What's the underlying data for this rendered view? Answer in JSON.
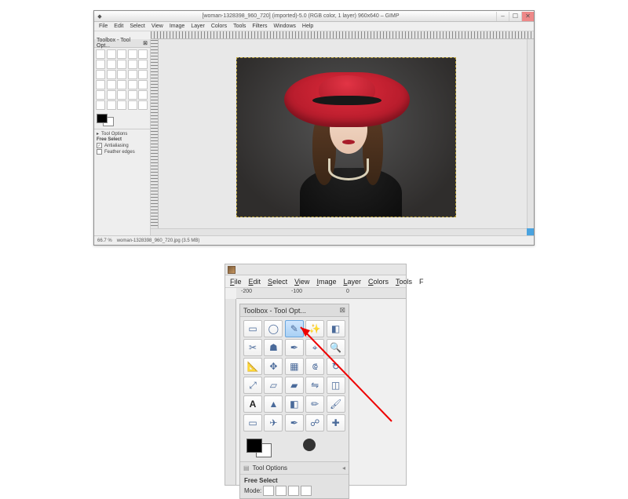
{
  "app": {
    "name": "GIMP"
  },
  "top_window": {
    "title": "[woman-1328398_960_720] (imported)-5.0 (RGB color, 1 layer) 960x640 – GIMP",
    "window_buttons": {
      "min": "–",
      "max": "☐",
      "close": "✕"
    },
    "menu": [
      "File",
      "Edit",
      "Select",
      "View",
      "Image",
      "Layer",
      "Colors",
      "Tools",
      "Filters",
      "Windows",
      "Help"
    ],
    "toolbox_title": "Toolbox - Tool Opt...",
    "tool_options": {
      "header": "Tool Options",
      "tool_name": "Free Select",
      "antialiasing_label": "Antialiasing",
      "antialiasing_checked": true,
      "feather_label": "Feather edges",
      "feather_checked": false
    },
    "status": {
      "zoom": "66.7 %",
      "file": "woman-1328398_960_720.jpg (3.5 MB)"
    }
  },
  "bottom_window": {
    "menu": [
      "File",
      "Edit",
      "Select",
      "View",
      "Image",
      "Layer",
      "Colors",
      "Tools",
      "F"
    ],
    "menu_underline_idx": [
      0,
      0,
      0,
      0,
      0,
      0,
      0,
      0,
      0
    ],
    "ruler_ticks_h": [
      "-200",
      "-100",
      "0"
    ],
    "toolbox_title": "Toolbox - Tool Opt...",
    "tools": [
      {
        "name": "rectangle-select-icon",
        "glyph": "▭"
      },
      {
        "name": "ellipse-select-icon",
        "glyph": "◯"
      },
      {
        "name": "free-select-icon",
        "glyph": "✎",
        "selected": true
      },
      {
        "name": "fuzzy-select-icon",
        "glyph": "✨"
      },
      {
        "name": "color-select-icon",
        "glyph": "◧"
      },
      {
        "name": "scissors-icon",
        "glyph": "✂"
      },
      {
        "name": "foreground-select-icon",
        "glyph": "☗"
      },
      {
        "name": "paths-icon",
        "glyph": "✒"
      },
      {
        "name": "color-picker-icon",
        "glyph": "⌖"
      },
      {
        "name": "zoom-icon",
        "glyph": "🔍"
      },
      {
        "name": "measure-icon",
        "glyph": "📐"
      },
      {
        "name": "move-icon",
        "glyph": "✥"
      },
      {
        "name": "align-icon",
        "glyph": "▦"
      },
      {
        "name": "crop-icon",
        "glyph": "⟃"
      },
      {
        "name": "rotate-icon",
        "glyph": "↻"
      },
      {
        "name": "scale-icon",
        "glyph": "⤢"
      },
      {
        "name": "shear-icon",
        "glyph": "▱"
      },
      {
        "name": "perspective-icon",
        "glyph": "▰"
      },
      {
        "name": "flip-icon",
        "glyph": "⇋"
      },
      {
        "name": "cage-icon",
        "glyph": "◫"
      },
      {
        "name": "text-icon",
        "glyph": "A"
      },
      {
        "name": "bucket-icon",
        "glyph": "▲"
      },
      {
        "name": "blend-icon",
        "glyph": "◧"
      },
      {
        "name": "pencil-icon",
        "glyph": "✏"
      },
      {
        "name": "paintbrush-icon",
        "glyph": "🖌"
      },
      {
        "name": "eraser-icon",
        "glyph": "▭"
      },
      {
        "name": "airbrush-icon",
        "glyph": "✈"
      },
      {
        "name": "ink-icon",
        "glyph": "✒"
      },
      {
        "name": "clone-icon",
        "glyph": "☍"
      },
      {
        "name": "heal-icon",
        "glyph": "✚"
      }
    ],
    "tool_options": {
      "header": "Tool Options",
      "tool_name": "Free Select",
      "mode_label": "Mode:"
    }
  }
}
